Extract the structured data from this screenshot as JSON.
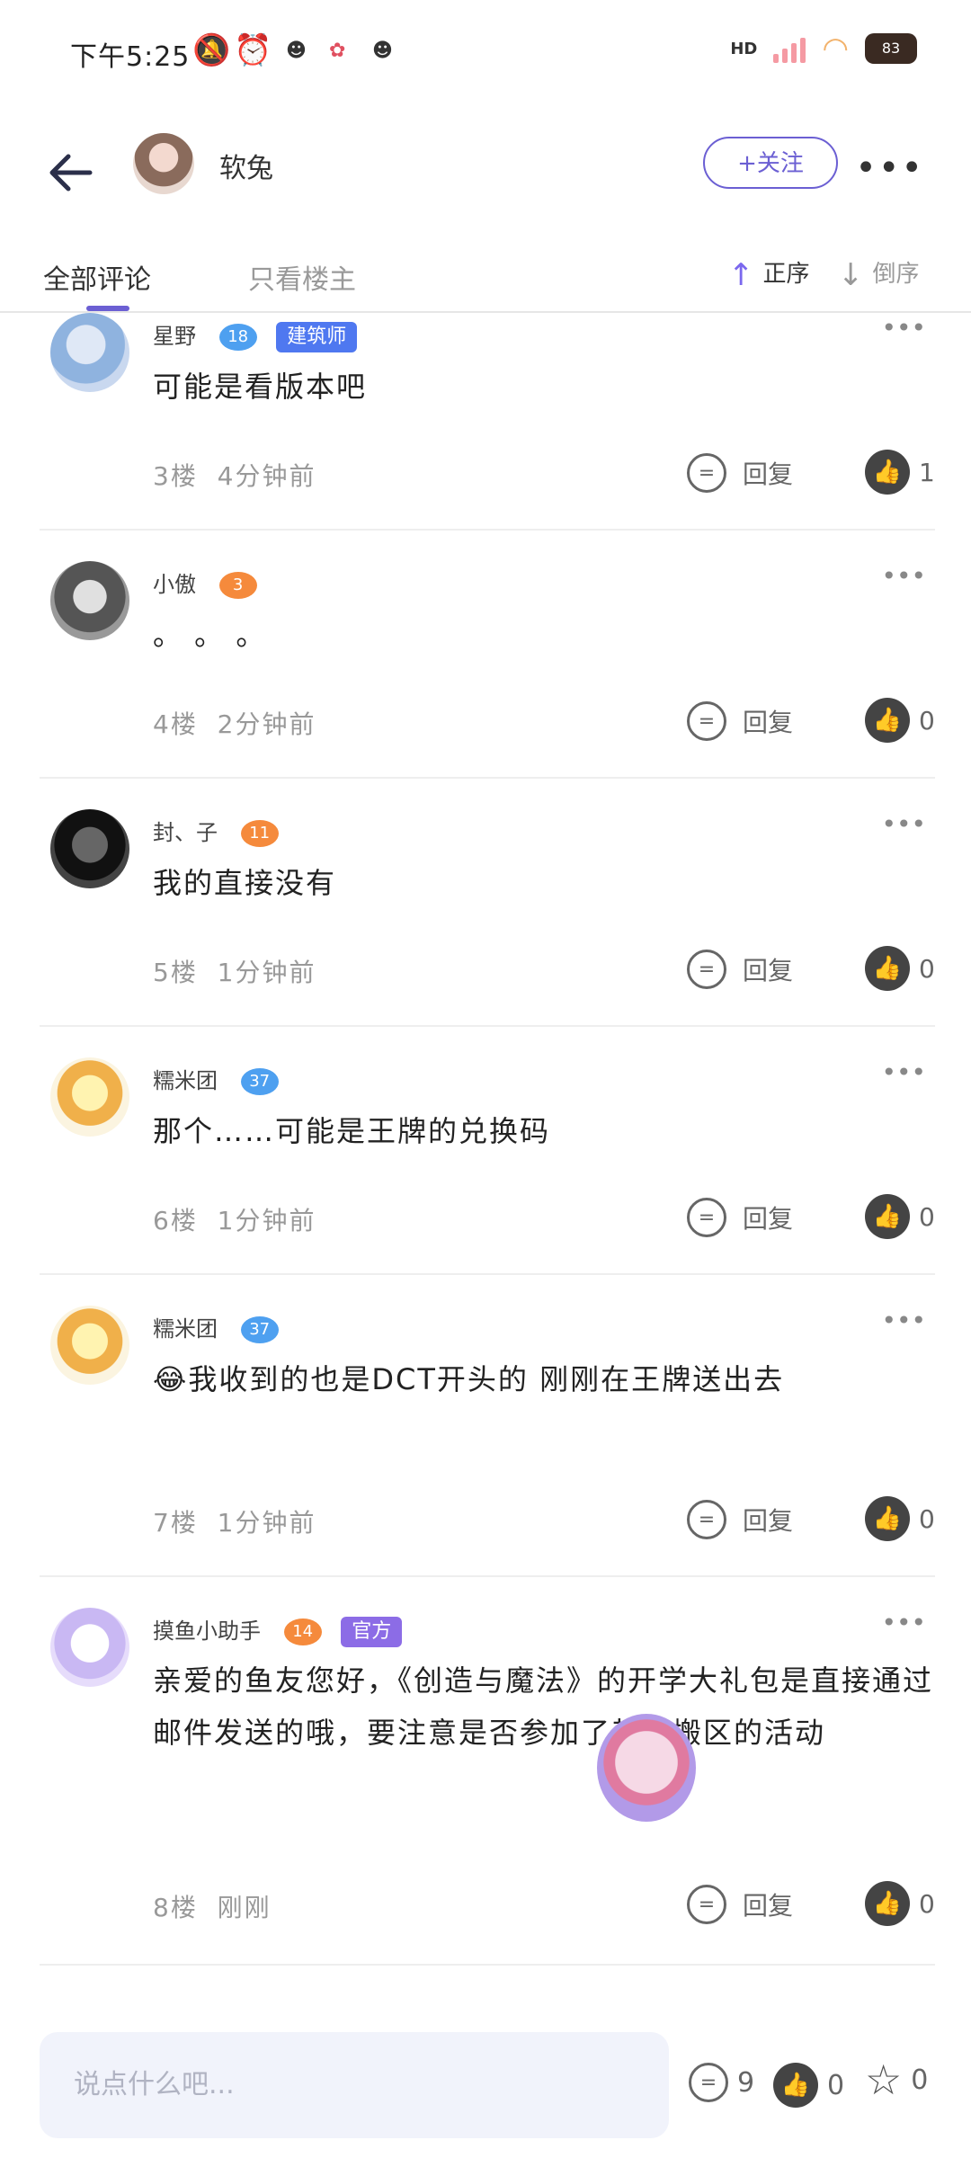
{
  "status_bar": {
    "time": "下午5:25",
    "hd": "HD",
    "battery": "83"
  },
  "header": {
    "author": "软兔",
    "follow_label": "+关注"
  },
  "tabs": {
    "all": "全部评论",
    "author_only": "只看楼主",
    "sort_asc": "正序",
    "sort_desc": "倒序"
  },
  "comments": [
    {
      "name": "星野",
      "level": "18",
      "tag": "建筑师",
      "text": "可能是看版本吧",
      "floor": "3楼",
      "time": "4分钟前",
      "reply": "回复",
      "likes": "1"
    },
    {
      "name": "小傲",
      "level": "3",
      "text": "。 。 。",
      "floor": "4楼",
      "time": "2分钟前",
      "reply": "回复",
      "likes": "0"
    },
    {
      "name": "封、子",
      "level": "11",
      "text": "我的直接没有",
      "floor": "5楼",
      "time": "1分钟前",
      "reply": "回复",
      "likes": "0"
    },
    {
      "name": "糯米团",
      "level": "37",
      "text": "那个……可能是王牌的兑换码",
      "floor": "6楼",
      "time": "1分钟前",
      "reply": "回复",
      "likes": "0"
    },
    {
      "name": "糯米团",
      "level": "37",
      "text": "😂我收到的也是DCT开头的  刚刚在王牌送出去",
      "floor": "7楼",
      "time": "1分钟前",
      "reply": "回复",
      "likes": "0"
    },
    {
      "name": "摸鱼小助手",
      "level": "14",
      "tag": "官方",
      "text": "亲爱的鱼友您好，《创造与魔法》的开学大礼包是直接通过邮件发送的哦，要注意是否参加了其他搬区的活动",
      "floor": "8楼",
      "time": "刚刚",
      "reply": "回复",
      "likes": "0"
    }
  ],
  "bottom": {
    "input_placeholder": "说点什么吧...",
    "comment_count": "9",
    "like_count": "0",
    "star_count": "0"
  },
  "colors": {
    "accent": "#6b5fd3",
    "tag_blue": "#4f78f0",
    "tag_purple": "#8c6ce6"
  }
}
